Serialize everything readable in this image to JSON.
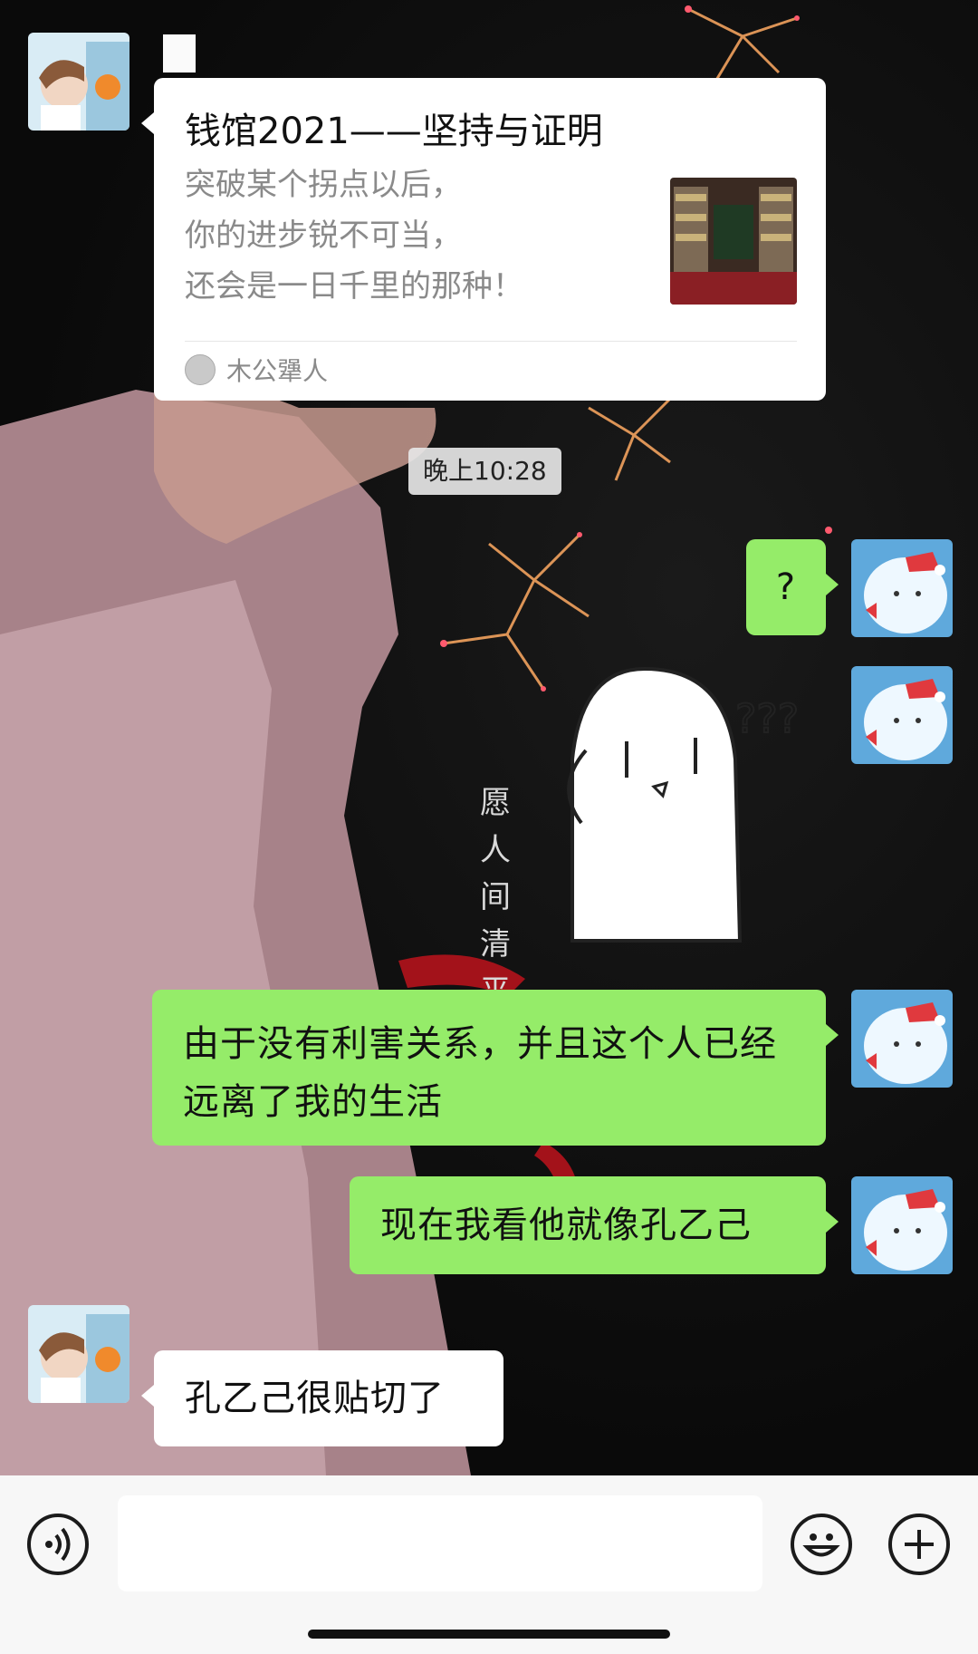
{
  "chat": {
    "messages": [
      {
        "type": "link_card",
        "sender": "other",
        "title": "钱馆2021——坚持与证明",
        "description_lines": [
          "突破某个拐点以后，",
          "你的进步锐不可当，",
          "还会是一日千里的那种！"
        ],
        "source": "木公犟人"
      },
      {
        "type": "timestamp",
        "text": "晚上10:28"
      },
      {
        "type": "text",
        "sender": "me",
        "text": "?"
      },
      {
        "type": "sticker",
        "sender": "me",
        "sticker": "ghost-question-sticker"
      },
      {
        "type": "text",
        "sender": "me",
        "text": "由于没有利害关系，并且这个人已经远离了我的生活"
      },
      {
        "type": "text",
        "sender": "me",
        "text": "现在我看他就像孔乙己"
      },
      {
        "type": "text",
        "sender": "other",
        "text": "孔乙己很贴切了"
      }
    ],
    "wallpaper_text": "愿人间清平月步胜"
  },
  "input_bar": {
    "voice_icon": "voice-icon",
    "emoji_icon": "emoji-icon",
    "add_icon": "add-icon"
  },
  "colors": {
    "sent_bubble": "#95ec69",
    "received_bubble": "#ffffff",
    "input_bar_bg": "#f7f7f7"
  }
}
